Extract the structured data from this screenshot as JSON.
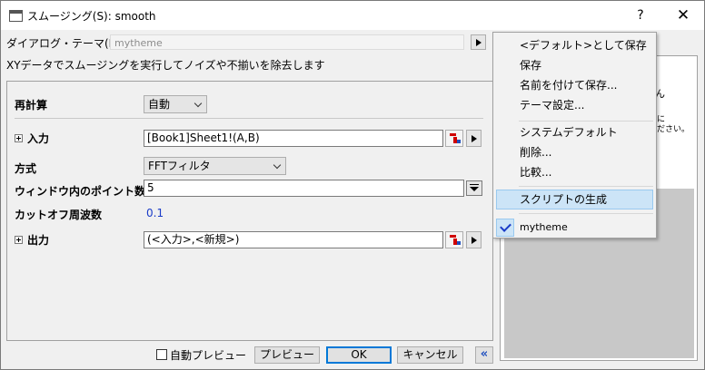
{
  "window": {
    "title": "スムージング(S): smooth",
    "help_label": "?",
    "close_label": "✕"
  },
  "theme": {
    "label": "ダイアログ・テーマ(H)",
    "value": "mytheme"
  },
  "description": "XYデータでスムージングを実行してノイズや不揃いを除去します",
  "form": {
    "recalc": {
      "label": "再計算",
      "value": "自動"
    },
    "input": {
      "label": "入力",
      "value": "[Book1]Sheet1!(A,B)"
    },
    "method": {
      "label": "方式",
      "value": "FFTフィルタ"
    },
    "window_points": {
      "label": "ウィンドウ内のポイント数",
      "value": "5"
    },
    "cutoff": {
      "label": "カットオフ周波数",
      "value": "0.1"
    },
    "output": {
      "label": "出力",
      "value": "(<入力>,<新規>)"
    }
  },
  "bottom": {
    "auto_preview_label": "自動プレビュー",
    "preview_label": "プレビュー",
    "ok_label": "OK",
    "cancel_label": "キャンセル",
    "collapse_label": "«"
  },
  "preview_fragments": {
    "line1": "ん",
    "line2": "に",
    "line3": "ださい。"
  },
  "menu": {
    "items": [
      "<デフォルト>として保存",
      "保存",
      "名前を付けて保存...",
      "テーマ設定...",
      "システムデフォルト",
      "削除...",
      "比較...",
      "スクリプトの生成",
      "mytheme"
    ],
    "highlighted": "スクリプトの生成",
    "checked": "mytheme"
  },
  "colors": {
    "highlight": "#cce4f7",
    "link_value": "#1a3cc8",
    "ok_border": "#0078d7"
  }
}
